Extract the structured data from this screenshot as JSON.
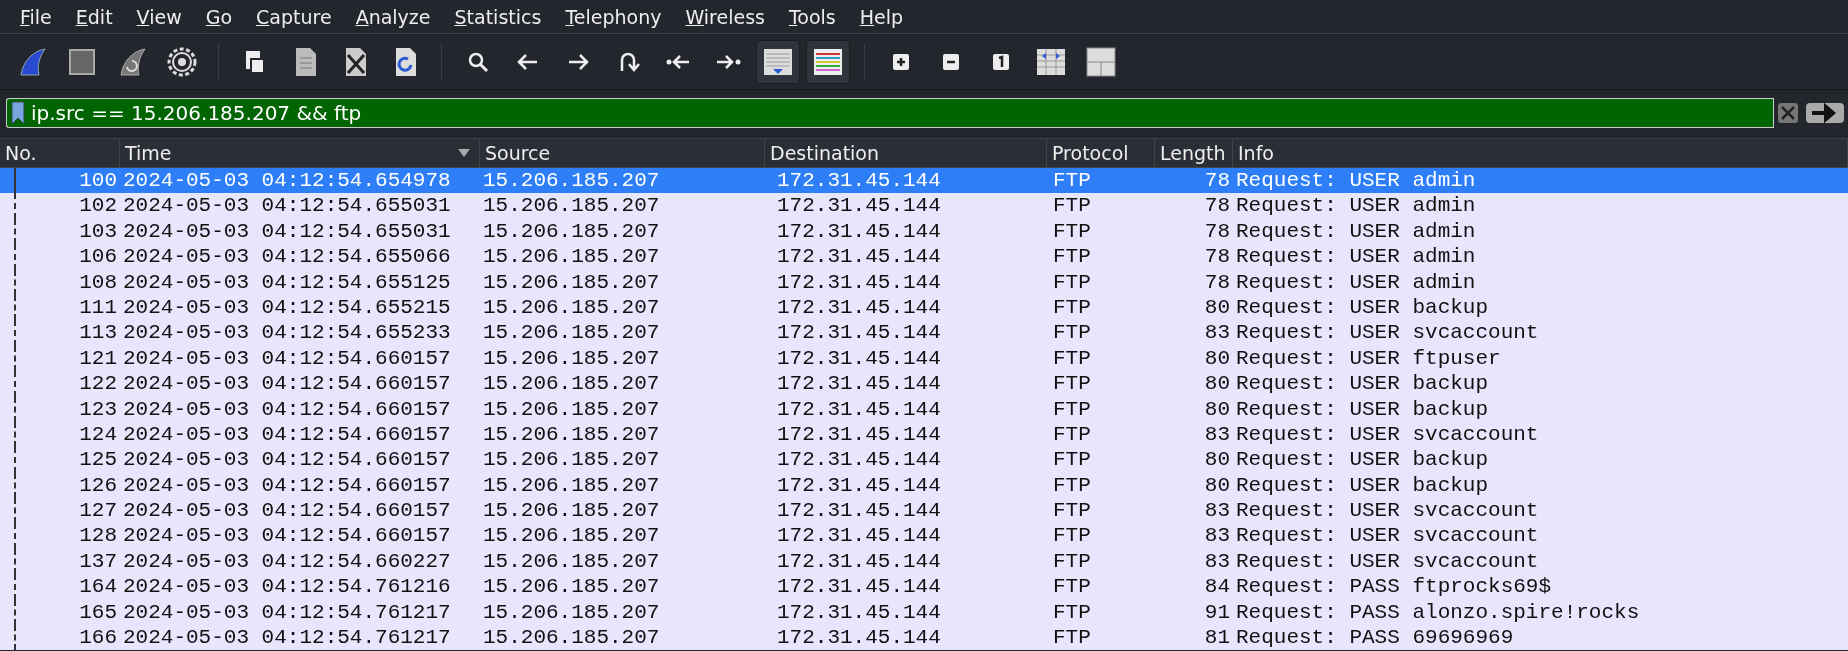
{
  "menu": [
    "File",
    "Edit",
    "View",
    "Go",
    "Capture",
    "Analyze",
    "Statistics",
    "Telephony",
    "Wireless",
    "Tools",
    "Help"
  ],
  "toolbar": {
    "groups": [
      [
        {
          "kind": "fin",
          "pressed": false
        },
        {
          "kind": "stop",
          "pressed": false
        },
        {
          "kind": "restart",
          "pressed": false
        },
        {
          "kind": "gear",
          "pressed": false
        }
      ],
      [
        {
          "kind": "open",
          "pressed": false
        },
        {
          "kind": "save",
          "pressed": false
        },
        {
          "kind": "close",
          "pressed": false
        },
        {
          "kind": "reload",
          "pressed": false
        }
      ],
      [
        {
          "kind": "search",
          "pressed": false
        },
        {
          "kind": "back",
          "pressed": false
        },
        {
          "kind": "forward",
          "pressed": false
        },
        {
          "kind": "goto",
          "pressed": false
        },
        {
          "kind": "first",
          "pressed": false
        },
        {
          "kind": "last",
          "pressed": false
        },
        {
          "kind": "autoscroll",
          "pressed": true
        },
        {
          "kind": "colorize",
          "pressed": true
        }
      ],
      [
        {
          "kind": "zoomin",
          "pressed": false
        },
        {
          "kind": "zoomout",
          "pressed": false
        },
        {
          "kind": "normal",
          "pressed": false
        },
        {
          "kind": "resize",
          "pressed": false
        },
        {
          "kind": "layout",
          "pressed": false
        }
      ]
    ]
  },
  "filter": {
    "value": "ip.src == 15.206.185.207 && ftp",
    "valid": true
  },
  "table": {
    "columns": [
      {
        "label": "No.",
        "sorted": false
      },
      {
        "label": "Time",
        "sorted": true
      },
      {
        "label": "Source",
        "sorted": false
      },
      {
        "label": "Destination",
        "sorted": false
      },
      {
        "label": "Protocol",
        "sorted": false
      },
      {
        "label": "Length",
        "sorted": false
      },
      {
        "label": "Info",
        "sorted": false
      }
    ],
    "rows": [
      {
        "selected": true,
        "cells": [
          "100",
          "2024-05-03 04:12:54.654978",
          "15.206.185.207",
          "172.31.45.144",
          "FTP",
          "78",
          "Request: USER admin"
        ]
      },
      {
        "selected": false,
        "cells": [
          "102",
          "2024-05-03 04:12:54.655031",
          "15.206.185.207",
          "172.31.45.144",
          "FTP",
          "78",
          "Request: USER admin"
        ]
      },
      {
        "selected": false,
        "cells": [
          "103",
          "2024-05-03 04:12:54.655031",
          "15.206.185.207",
          "172.31.45.144",
          "FTP",
          "78",
          "Request: USER admin"
        ]
      },
      {
        "selected": false,
        "cells": [
          "106",
          "2024-05-03 04:12:54.655066",
          "15.206.185.207",
          "172.31.45.144",
          "FTP",
          "78",
          "Request: USER admin"
        ]
      },
      {
        "selected": false,
        "cells": [
          "108",
          "2024-05-03 04:12:54.655125",
          "15.206.185.207",
          "172.31.45.144",
          "FTP",
          "78",
          "Request: USER admin"
        ]
      },
      {
        "selected": false,
        "cells": [
          "111",
          "2024-05-03 04:12:54.655215",
          "15.206.185.207",
          "172.31.45.144",
          "FTP",
          "80",
          "Request: USER backup"
        ]
      },
      {
        "selected": false,
        "cells": [
          "113",
          "2024-05-03 04:12:54.655233",
          "15.206.185.207",
          "172.31.45.144",
          "FTP",
          "83",
          "Request: USER svcaccount"
        ]
      },
      {
        "selected": false,
        "cells": [
          "121",
          "2024-05-03 04:12:54.660157",
          "15.206.185.207",
          "172.31.45.144",
          "FTP",
          "80",
          "Request: USER ftpuser"
        ]
      },
      {
        "selected": false,
        "cells": [
          "122",
          "2024-05-03 04:12:54.660157",
          "15.206.185.207",
          "172.31.45.144",
          "FTP",
          "80",
          "Request: USER backup"
        ]
      },
      {
        "selected": false,
        "cells": [
          "123",
          "2024-05-03 04:12:54.660157",
          "15.206.185.207",
          "172.31.45.144",
          "FTP",
          "80",
          "Request: USER backup"
        ]
      },
      {
        "selected": false,
        "cells": [
          "124",
          "2024-05-03 04:12:54.660157",
          "15.206.185.207",
          "172.31.45.144",
          "FTP",
          "83",
          "Request: USER svcaccount"
        ]
      },
      {
        "selected": false,
        "cells": [
          "125",
          "2024-05-03 04:12:54.660157",
          "15.206.185.207",
          "172.31.45.144",
          "FTP",
          "80",
          "Request: USER backup"
        ]
      },
      {
        "selected": false,
        "cells": [
          "126",
          "2024-05-03 04:12:54.660157",
          "15.206.185.207",
          "172.31.45.144",
          "FTP",
          "80",
          "Request: USER backup"
        ]
      },
      {
        "selected": false,
        "cells": [
          "127",
          "2024-05-03 04:12:54.660157",
          "15.206.185.207",
          "172.31.45.144",
          "FTP",
          "83",
          "Request: USER svcaccount"
        ]
      },
      {
        "selected": false,
        "cells": [
          "128",
          "2024-05-03 04:12:54.660157",
          "15.206.185.207",
          "172.31.45.144",
          "FTP",
          "83",
          "Request: USER svcaccount"
        ]
      },
      {
        "selected": false,
        "cells": [
          "137",
          "2024-05-03 04:12:54.660227",
          "15.206.185.207",
          "172.31.45.144",
          "FTP",
          "83",
          "Request: USER svcaccount"
        ]
      },
      {
        "selected": false,
        "cells": [
          "164",
          "2024-05-03 04:12:54.761216",
          "15.206.185.207",
          "172.31.45.144",
          "FTP",
          "84",
          "Request: PASS ftprocks69$"
        ]
      },
      {
        "selected": false,
        "cells": [
          "165",
          "2024-05-03 04:12:54.761217",
          "15.206.185.207",
          "172.31.45.144",
          "FTP",
          "91",
          "Request: PASS alonzo.spire!rocks"
        ]
      },
      {
        "selected": false,
        "cells": [
          "166",
          "2024-05-03 04:12:54.761217",
          "15.206.185.207",
          "172.31.45.144",
          "FTP",
          "81",
          "Request: PASS 69696969"
        ]
      }
    ]
  }
}
